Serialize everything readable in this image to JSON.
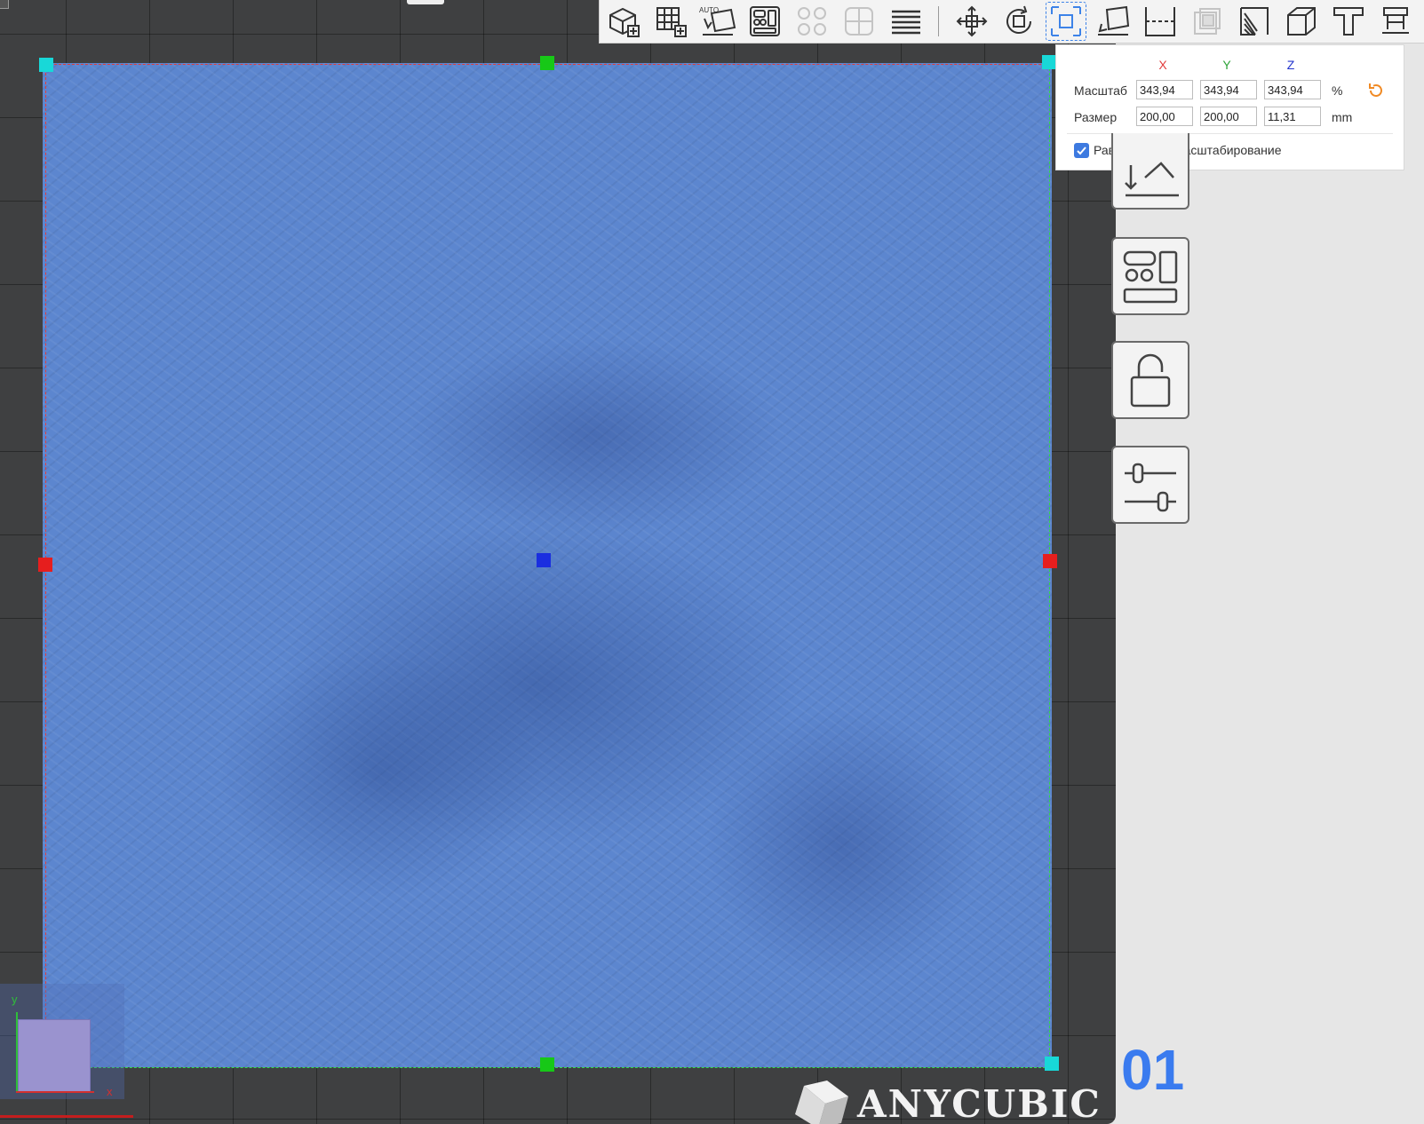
{
  "scale_panel": {
    "headers": {
      "x": "X",
      "y": "Y",
      "z": "Z"
    },
    "scale_label": "Масштаб",
    "size_label": "Размер",
    "scale": {
      "x": "343,94",
      "y": "343,94",
      "z": "343,94",
      "unit": "%"
    },
    "size": {
      "x": "200,00",
      "y": "200,00",
      "z": "11,31",
      "unit": "mm"
    },
    "uniform_scaling": {
      "label": "Равномерное масштабирование",
      "checked": true
    }
  },
  "viewport": {
    "axis_labels": {
      "x": "x",
      "y": "y"
    },
    "brand": "ANYCUBIC",
    "plate_number": "01"
  },
  "toolbar": {
    "items": [
      {
        "icon": "add-cube-icon",
        "state": "normal"
      },
      {
        "icon": "grid-add-icon",
        "state": "normal"
      },
      {
        "icon": "auto-orient-icon",
        "state": "normal"
      },
      {
        "icon": "layout-icon",
        "state": "normal"
      },
      {
        "icon": "split-icon",
        "state": "disabled"
      },
      {
        "icon": "merge-icon",
        "state": "disabled"
      },
      {
        "icon": "layers-icon",
        "state": "normal"
      },
      {
        "icon": "move-icon",
        "state": "normal"
      },
      {
        "icon": "rotate-icon",
        "state": "normal"
      },
      {
        "icon": "scale-icon",
        "state": "active"
      },
      {
        "icon": "lay-flat-icon",
        "state": "normal"
      },
      {
        "icon": "cut-icon",
        "state": "normal"
      },
      {
        "icon": "hollow-icon",
        "state": "disabled"
      },
      {
        "icon": "support-icon",
        "state": "normal"
      },
      {
        "icon": "measure-icon",
        "state": "normal"
      },
      {
        "icon": "text-icon",
        "state": "normal"
      },
      {
        "icon": "stand-icon",
        "state": "normal"
      }
    ],
    "auto_badge": "AUTO"
  },
  "colors": {
    "model": "#5c86cf",
    "accent": "#3d83e8",
    "reset": "#f08a24",
    "x_axis": "#e23c3c",
    "y_axis": "#2fbf3a",
    "z_axis": "#2233cc",
    "plate_number": "#3a7bef"
  }
}
